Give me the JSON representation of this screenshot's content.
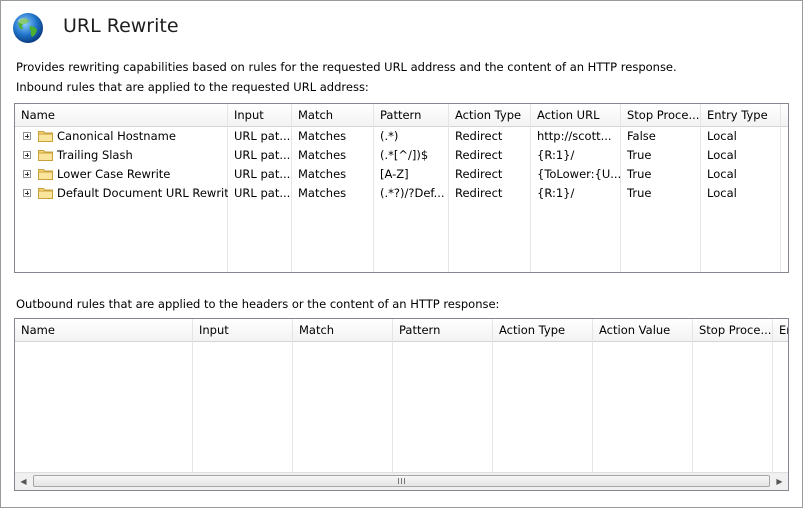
{
  "page": {
    "title": "URL Rewrite",
    "description": "Provides rewriting capabilities based on rules for the requested URL address and the content of an HTTP response.",
    "inbound_caption": "Inbound rules that are applied to the requested URL address:",
    "outbound_caption": "Outbound rules that are applied to the headers or the content of an HTTP response:"
  },
  "inbound": {
    "columns": [
      "Name",
      "Input",
      "Match",
      "Pattern",
      "Action Type",
      "Action URL",
      "Stop Proce...",
      "Entry Type"
    ],
    "rows": [
      [
        "Canonical Hostname",
        "URL pat...",
        "Matches",
        "(.*)",
        "Redirect",
        "http://scott...",
        "False",
        "Local"
      ],
      [
        "Trailing Slash",
        "URL pat...",
        "Matches",
        "(.*[^/])$",
        "Redirect",
        "{R:1}/",
        "True",
        "Local"
      ],
      [
        "Lower Case Rewrite",
        "URL pat...",
        "Matches",
        "[A-Z]",
        "Redirect",
        "{ToLower:{U...",
        "True",
        "Local"
      ],
      [
        "Default Document URL Rewrite",
        "URL pat...",
        "Matches",
        "(.*?)/?Def...",
        "Redirect",
        "{R:1}/",
        "True",
        "Local"
      ]
    ]
  },
  "outbound": {
    "columns": [
      "Name",
      "Input",
      "Match",
      "Pattern",
      "Action Type",
      "Action Value",
      "Stop Proce...",
      "En"
    ],
    "rows": []
  },
  "icons": {
    "title": "globe-icon",
    "expand": "plus-expander-icon",
    "rule": "folder-icon"
  }
}
